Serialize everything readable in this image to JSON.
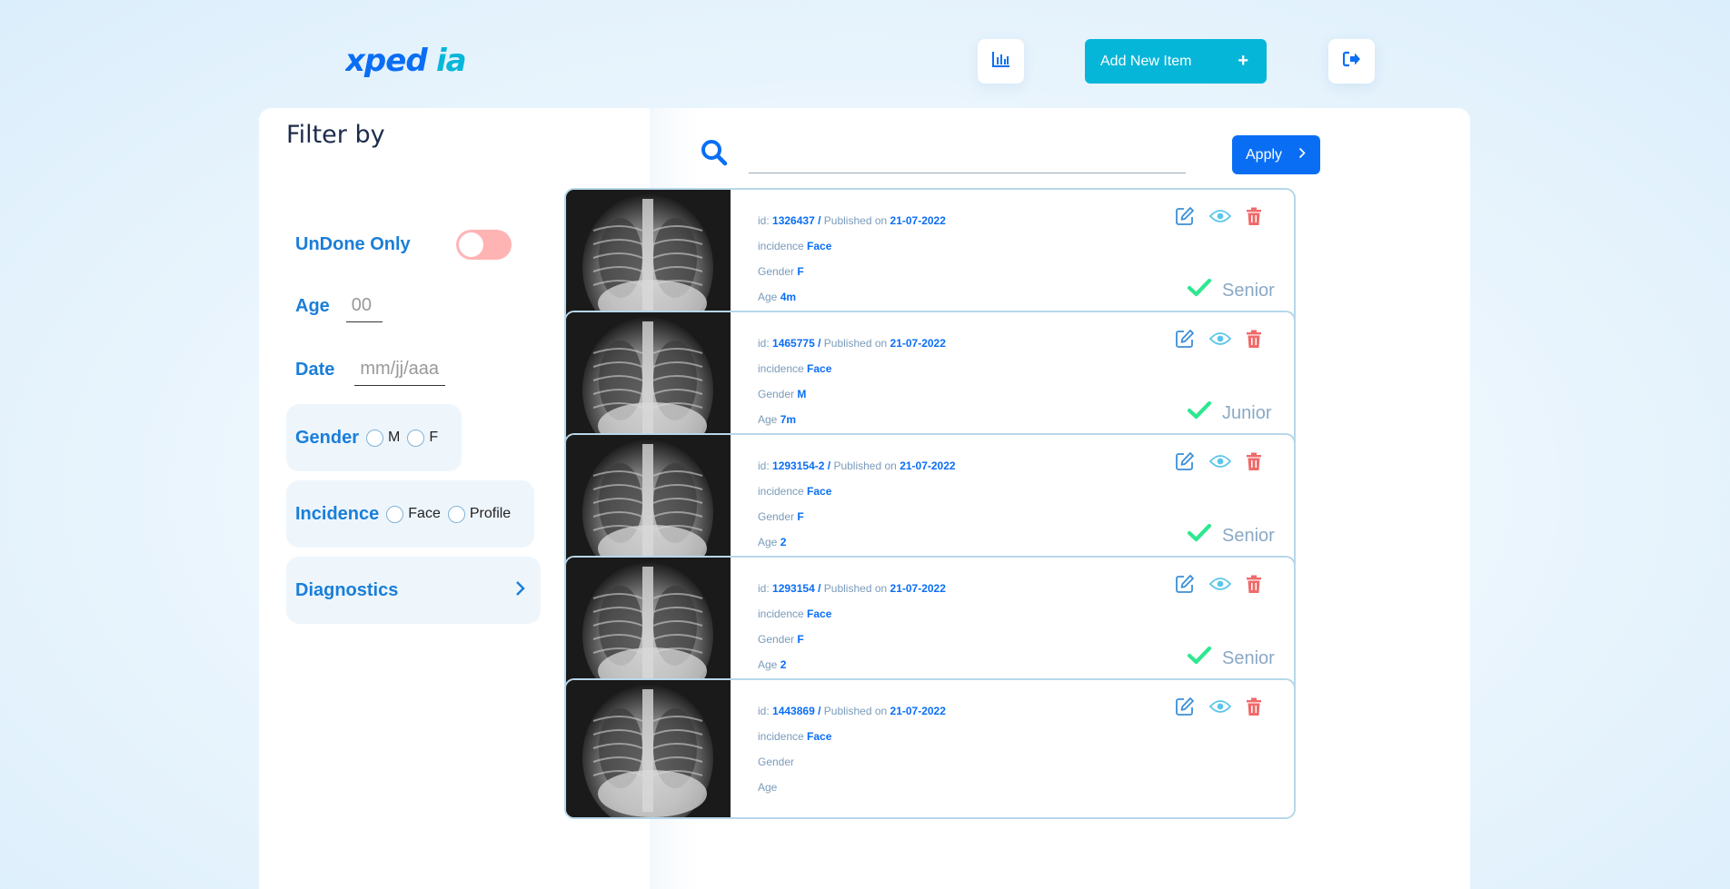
{
  "header": {
    "logo_text": "xpedia",
    "add_button_label": "Add New Item",
    "add_button_icon": "plus-icon",
    "stats_icon": "bar-chart-icon",
    "logout_icon": "logout-icon"
  },
  "filter": {
    "title": "Filter by",
    "undone_label": "UnDone Only",
    "age_label": "Age",
    "age_placeholder": "00",
    "date_label": "Date",
    "date_placeholder": "mm/jj/aaaa",
    "gender_label": "Gender",
    "gender_options": [
      "M",
      "F"
    ],
    "incidence_label": "Incidence",
    "incidence_options": [
      "Face",
      "Profile"
    ],
    "diagnostics_label": "Diagnostics"
  },
  "search": {
    "placeholder": "",
    "apply_label": "Apply"
  },
  "labels": {
    "id": "id:",
    "sep": "/",
    "published": "Published on",
    "incidence": "incidence",
    "gender": "Gender",
    "age": "Age"
  },
  "items": [
    {
      "id": "1326437",
      "date": "21-07-2022",
      "incidence": "Face",
      "gender": "F",
      "age": "4m",
      "level": "Senior"
    },
    {
      "id": "1465775",
      "date": "21-07-2022",
      "incidence": "Face",
      "gender": "M",
      "age": "7m",
      "level": "Junior"
    },
    {
      "id": "1293154-2",
      "date": "21-07-2022",
      "incidence": "Face",
      "gender": "F",
      "age": "2",
      "level": "Senior"
    },
    {
      "id": "1293154",
      "date": "21-07-2022",
      "incidence": "Face",
      "gender": "F",
      "age": "2",
      "level": "Senior"
    },
    {
      "id": "1443869",
      "date": "21-07-2022",
      "incidence": "Face",
      "gender": "",
      "age": "",
      "level": ""
    }
  ],
  "colors": {
    "accent": "#0a6ef5",
    "cyan": "#06b6d8",
    "label_blue": "#1a7ed9",
    "delete_red": "#f06a6a",
    "check_green": "#2ee88f",
    "toggle_off": "#ffb4b4"
  }
}
